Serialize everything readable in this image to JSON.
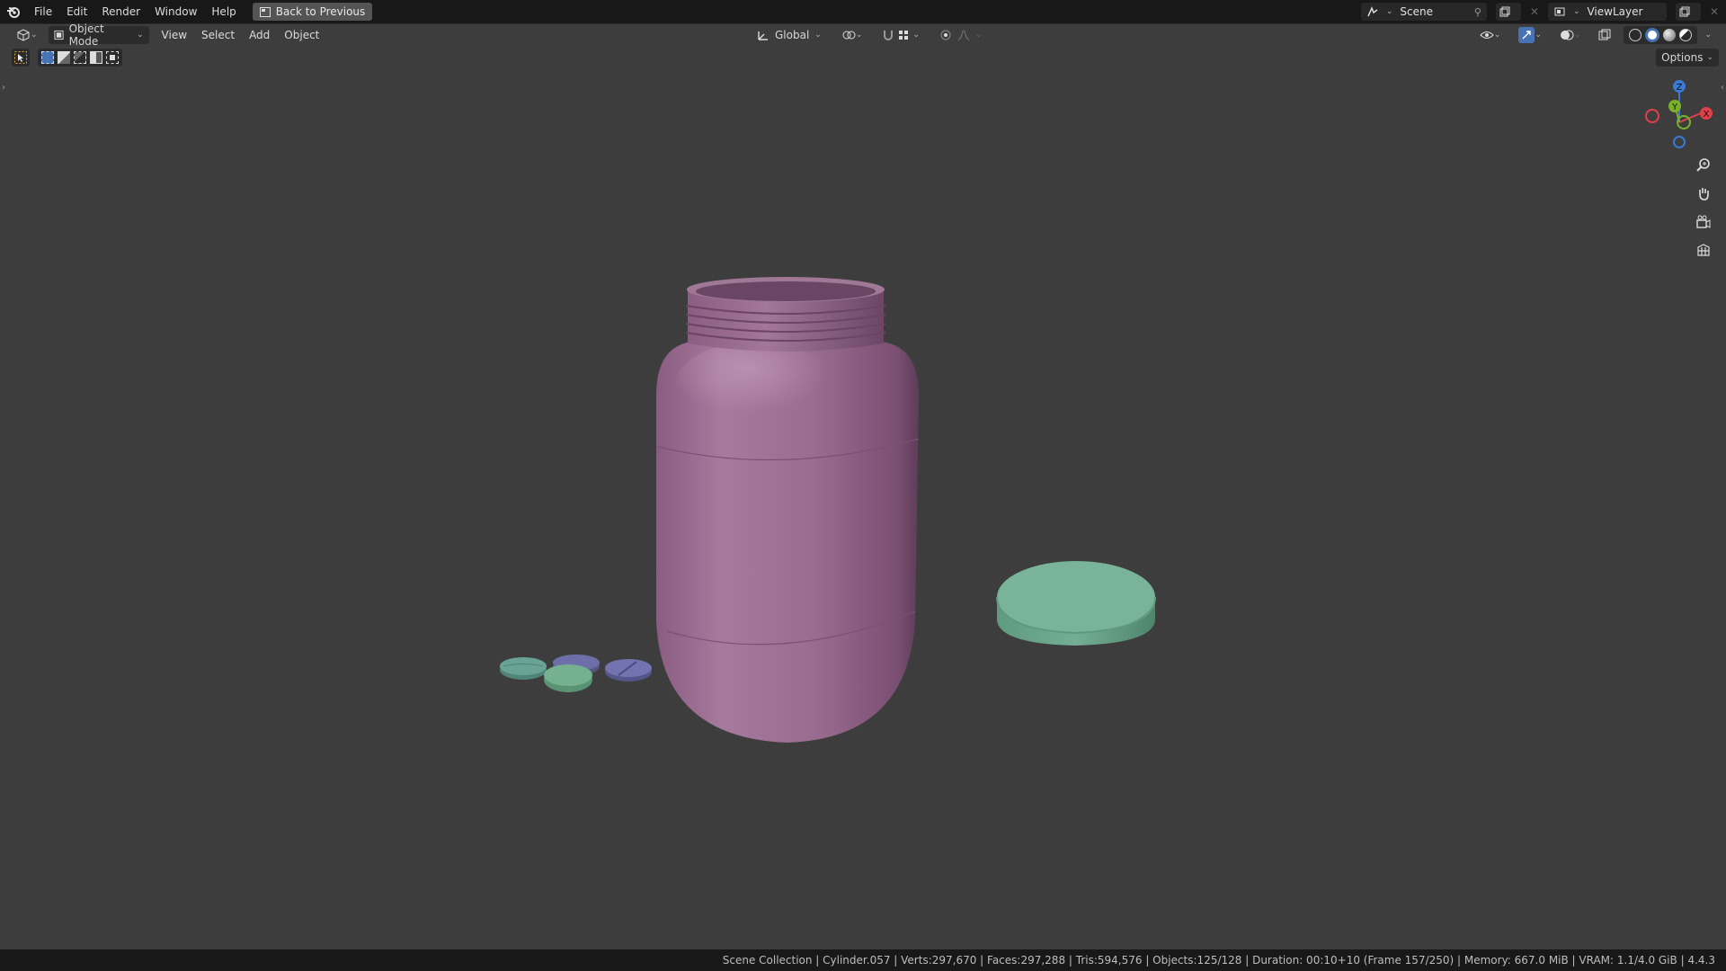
{
  "topbar": {
    "menus": [
      "File",
      "Edit",
      "Render",
      "Window",
      "Help"
    ],
    "back_label": "Back to Previous",
    "scene_name": "Scene",
    "view_layer": "ViewLayer"
  },
  "header": {
    "mode": "Object Mode",
    "menus": [
      "View",
      "Select",
      "Add",
      "Object"
    ],
    "transform_orientation": "Global",
    "options_label": "Options"
  },
  "status": {
    "text": "Scene Collection | Cylinder.057 | Verts:297,670 | Faces:297,288 | Tris:594,576 | Objects:125/128 | Duration: 00:10+10 (Frame 157/250) | Memory: 667.0 MiB | VRAM: 1.1/4.0 GiB | 4.4.3"
  },
  "gizmo": {
    "z": "Z",
    "y": "Y",
    "x": "X"
  },
  "colors": {
    "bottle": "#9b6e93",
    "cap": "#6fa88f",
    "pill_teal": "#6aa396",
    "pill_purple": "#6e6fa8",
    "pill_green": "#75b08f",
    "viewport_bg": "#3d3d3d"
  }
}
